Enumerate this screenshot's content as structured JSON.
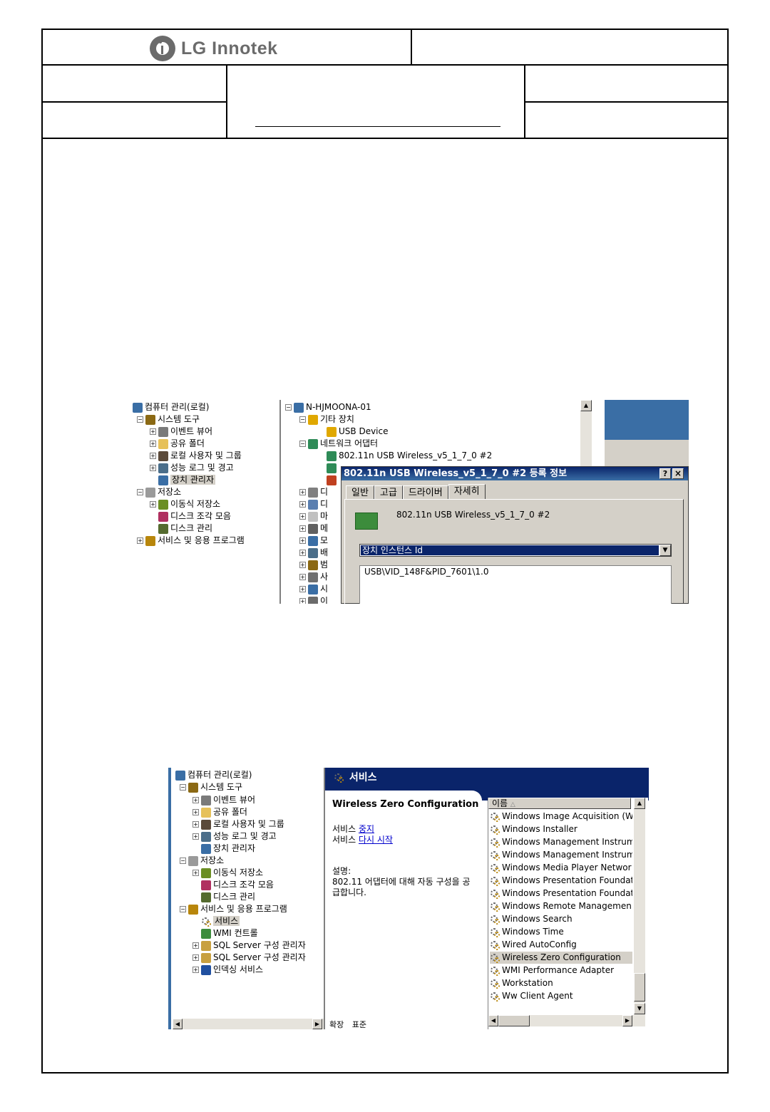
{
  "header": {
    "company_name": "LG Innotek",
    "top_right_cell": "",
    "left_top_cell": "",
    "left_bottom_cell": "",
    "center_cell": "",
    "right_top_cell": "",
    "right_bottom_cell": ""
  },
  "device_manager_screenshot": {
    "tree": {
      "root": "컴퓨터 관리(로컬)",
      "system_tools": "시스템 도구",
      "event_viewer": "이벤트 뷰어",
      "shared_folders": "공유 폴더",
      "local_users": "로컬 사용자 및 그룹",
      "perf_logs": "성능 로그 및 경고",
      "device_manager": "장치 관리자",
      "storage": "저장소",
      "removable_storage": "이동식 저장소",
      "defrag": "디스크 조각 모음",
      "disk_management": "디스크 관리",
      "services_apps": "서비스 및 응용 프로그램"
    },
    "devices": {
      "computer": "N-HJMOONA-01",
      "other_devices": "기타 장치",
      "usb_device": "USB Device",
      "network_adapters": "네트워크 어댑터",
      "adapter_1": "802.11n USB Wireless_v5_1_7_0 #2",
      "collapsed_prefixes": [
        "디",
        "디",
        "마",
        "메",
        "모",
        "배",
        "범",
        "사",
        "시",
        "이"
      ]
    },
    "dialog": {
      "title": "802.11n USB Wireless_v5_1_7_0 #2 등록 정보",
      "help_btn": "?",
      "close_btn": "×",
      "tabs": [
        "일반",
        "고급",
        "드라이버",
        "자세히"
      ],
      "active_tab": "자세히",
      "device_name": "802.11n USB Wireless_v5_1_7_0 #2",
      "property_select": "장치 인스턴스 Id",
      "property_value": "USB\\VID_148F&PID_7601\\1.0"
    }
  },
  "services_screenshot": {
    "tree": {
      "root": "컴퓨터 관리(로컬)",
      "system_tools": "시스템 도구",
      "event_viewer": "이벤트 뷰어",
      "shared_folders": "공유 폴더",
      "local_users": "로컬 사용자 및 그룹",
      "perf_logs": "성능 로그 및 경고",
      "device_manager": "장치 관리자",
      "storage": "저장소",
      "removable_storage": "이동식 저장소",
      "defrag": "디스크 조각 모음",
      "disk_management": "디스크 관리",
      "services_apps": "서비스 및 응용 프로그램",
      "services": "서비스",
      "wmi": "WMI 컨트롤",
      "sql_1": "SQL Server 구성 관리자",
      "sql_2": "SQL Server 구성 관리자",
      "indexing": "인덱싱 서비스"
    },
    "header_title": "서비스",
    "detail": {
      "service_name": "Wireless Zero Configuration",
      "stop_prefix": "서비스",
      "stop_link": "중지",
      "restart_prefix": "서비스",
      "restart_link": "다시 시작",
      "desc_label": "설명:",
      "desc_line1": "802.11 어댑터에 대해 자동 구성을 공",
      "desc_line2": "급합니다."
    },
    "list_header": "이름",
    "sort_glyph": "△",
    "services_list": [
      "Windows Image Acquisition (W",
      "Windows Installer",
      "Windows Management Instrum",
      "Windows Management Instrum",
      "Windows Media Player Networ",
      "Windows Presentation Foundat",
      "Windows Presentation Foundat",
      "Windows Remote Managemen",
      "Windows Search",
      "Windows Time",
      "Wired AutoConfig",
      "Wireless Zero Configuration",
      "WMI Performance Adapter",
      "Workstation",
      "Ww Client Agent"
    ],
    "selected_index": 11,
    "bottom_tabs": [
      "확장",
      "표준"
    ]
  }
}
